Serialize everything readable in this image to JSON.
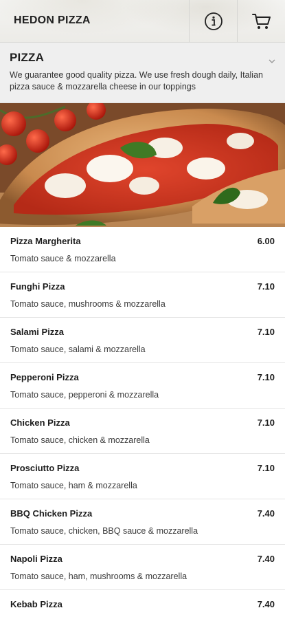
{
  "header": {
    "brand": "HEDON PIZZA",
    "info_icon": "info-icon",
    "cart_icon": "cart-icon"
  },
  "category": {
    "title": "PIZZA",
    "description": "We guarantee good quality pizza. We use fresh dough daily, Italian pizza sauce & mozzarella cheese in our toppings",
    "chevron_icon": "chevron-down-icon"
  },
  "menu": {
    "items": [
      {
        "name": "Pizza Margherita",
        "price": "6.00",
        "description": "Tomato sauce & mozzarella"
      },
      {
        "name": "Funghi Pizza",
        "price": "7.10",
        "description": "Tomato sauce, mushrooms & mozzarella"
      },
      {
        "name": "Salami Pizza",
        "price": "7.10",
        "description": "Tomato sauce, salami & mozzarella"
      },
      {
        "name": "Pepperoni Pizza",
        "price": "7.10",
        "description": "Tomato sauce, pepperoni & mozzarella"
      },
      {
        "name": "Chicken Pizza",
        "price": "7.10",
        "description": "Tomato sauce, chicken & mozzarella"
      },
      {
        "name": "Prosciutto Pizza",
        "price": "7.10",
        "description": "Tomato sauce, ham & mozzarella"
      },
      {
        "name": "BBQ Chicken Pizza",
        "price": "7.40",
        "description": "Tomato sauce, chicken, BBQ sauce & mozzarella"
      },
      {
        "name": "Napoli Pizza",
        "price": "7.40",
        "description": "Tomato sauce, ham, mushrooms & mozzarella"
      },
      {
        "name": "Kebab Pizza",
        "price": "7.40",
        "description": ""
      }
    ]
  }
}
